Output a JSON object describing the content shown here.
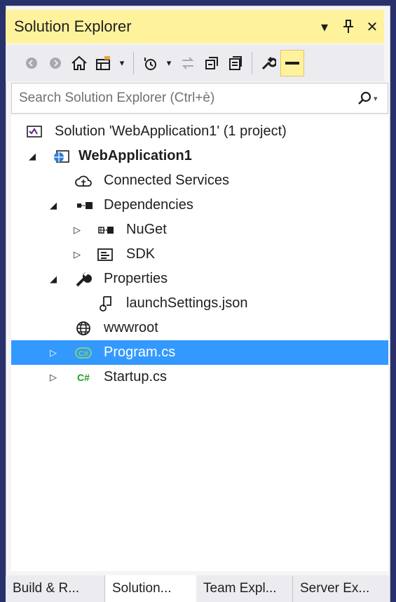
{
  "window": {
    "title": "Solution Explorer",
    "controls": {
      "dropdown": "▾",
      "pin": "⊥",
      "close": "✕"
    }
  },
  "toolbar": {
    "buttons": [
      {
        "name": "back-icon",
        "glyph": "⊖",
        "disabled": true
      },
      {
        "name": "forward-icon",
        "glyph": "⊖",
        "disabled": true
      },
      {
        "name": "home-icon",
        "glyph": "⌂",
        "disabled": false
      },
      {
        "name": "switch-views-icon",
        "glyph": "⊞",
        "disabled": false
      },
      {
        "name": "pending-changes-icon",
        "glyph": "⏲",
        "disabled": false
      },
      {
        "name": "sync-icon",
        "glyph": "⇆",
        "disabled": true
      },
      {
        "name": "collapse-all-icon",
        "glyph": "⧉",
        "disabled": false
      },
      {
        "name": "show-all-files-icon",
        "glyph": "▤",
        "disabled": false
      },
      {
        "name": "properties-icon",
        "glyph": "🔧",
        "disabled": false
      },
      {
        "name": "preview-selected-icon",
        "glyph": "▬",
        "disabled": false
      }
    ]
  },
  "search": {
    "placeholder": "Search Solution Explorer (Ctrl+è)",
    "value": ""
  },
  "tree": {
    "items": [
      {
        "label": "Solution 'WebApplication1' (1 project)",
        "icon": "solution-icon",
        "expander": "",
        "level": 0,
        "bold": false,
        "selected": false
      },
      {
        "label": "WebApplication1",
        "icon": "web-project-icon",
        "expander": "◢",
        "level": 1,
        "bold": true,
        "selected": false
      },
      {
        "label": "Connected Services",
        "icon": "cloud-icon",
        "expander": "",
        "level": 2,
        "bold": false,
        "selected": false
      },
      {
        "label": "Dependencies",
        "icon": "dependencies-icon",
        "expander": "◢",
        "level": 2,
        "bold": false,
        "selected": false
      },
      {
        "label": "NuGet",
        "icon": "nuget-icon",
        "expander": "▷",
        "level": 3,
        "bold": false,
        "selected": false
      },
      {
        "label": "SDK",
        "icon": "sdk-icon",
        "expander": "▷",
        "level": 3,
        "bold": false,
        "selected": false
      },
      {
        "label": "Properties",
        "icon": "wrench-icon",
        "expander": "◢",
        "level": 2,
        "bold": false,
        "selected": false
      },
      {
        "label": "launchSettings.json",
        "icon": "json-icon",
        "expander": "",
        "level": 3,
        "bold": false,
        "selected": false
      },
      {
        "label": "wwwroot",
        "icon": "globe-icon",
        "expander": "",
        "level": 2,
        "bold": false,
        "selected": false
      },
      {
        "label": "Program.cs",
        "icon": "csharp-file-icon",
        "expander": "▷",
        "level": 2,
        "bold": false,
        "selected": true
      },
      {
        "label": "Startup.cs",
        "icon": "csharp-file-icon",
        "expander": "▷",
        "level": 2,
        "bold": false,
        "selected": false
      }
    ]
  },
  "bottom_tabs": [
    {
      "label": "Build & R...",
      "active": false
    },
    {
      "label": "Solution...",
      "active": true
    },
    {
      "label": "Team Expl...",
      "active": false
    },
    {
      "label": "Server Ex...",
      "active": false
    }
  ],
  "colors": {
    "title_bar": "#fff29d",
    "selection": "#3399ff",
    "csharp_green": "#1e9f1e",
    "project_blue": "#2d7fd3"
  }
}
